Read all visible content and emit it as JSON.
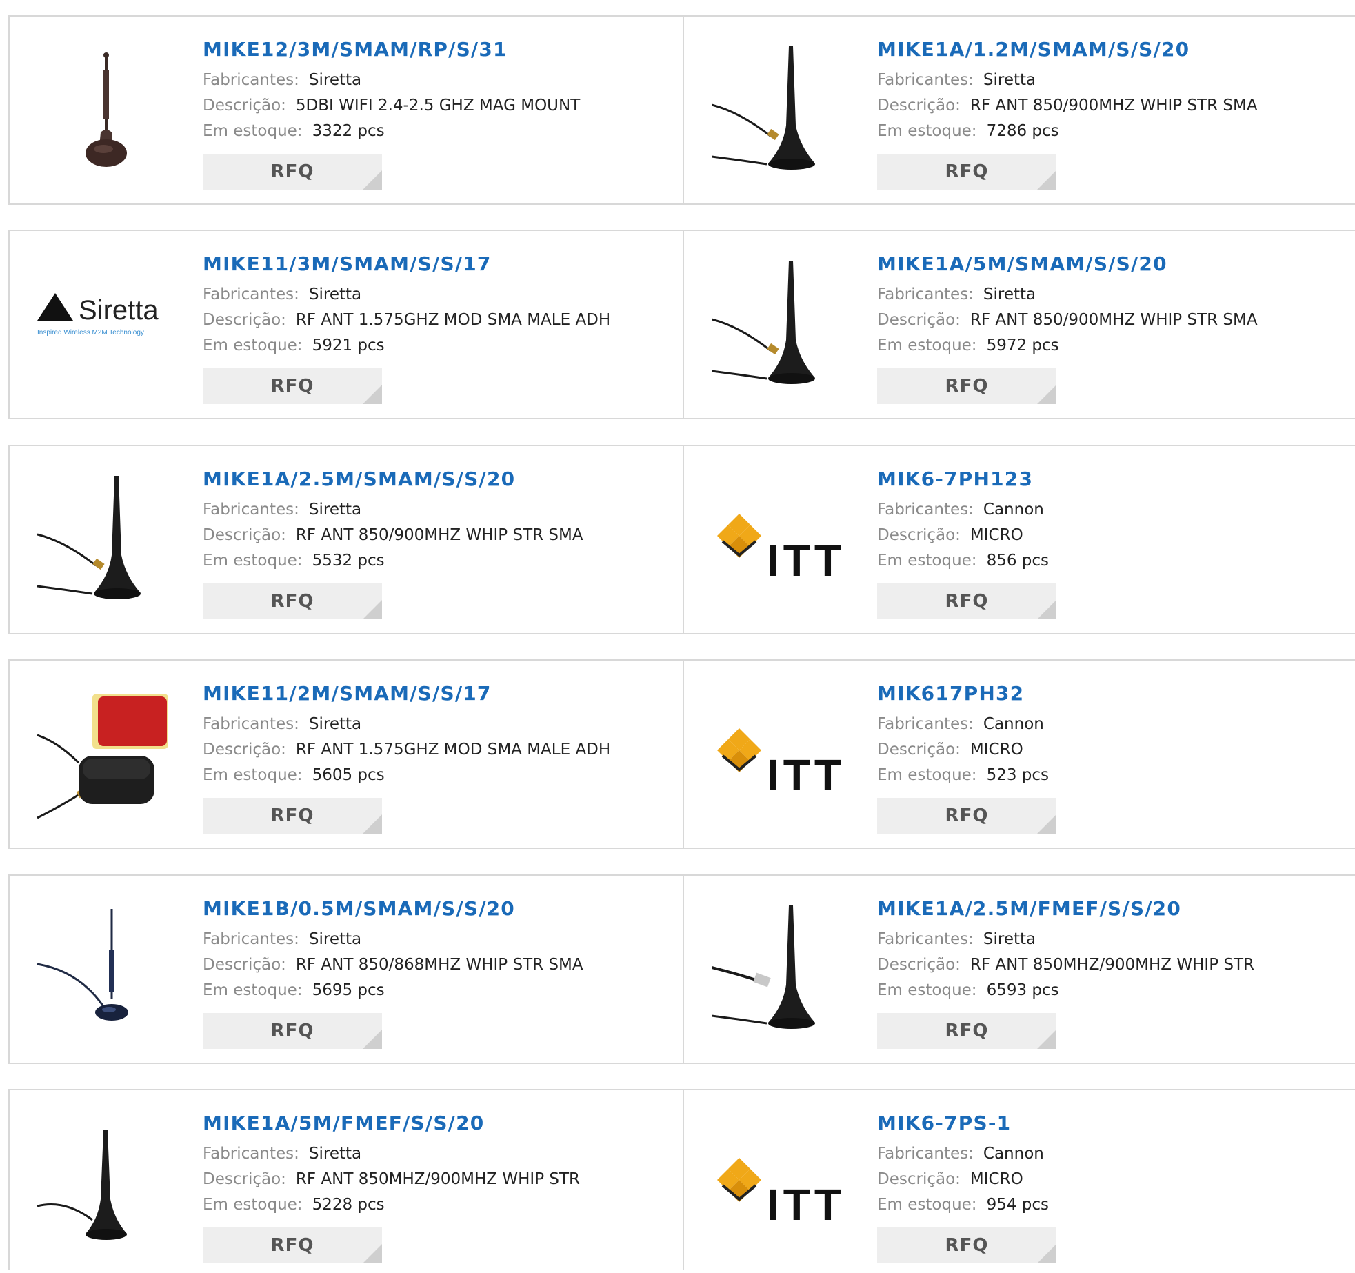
{
  "labels": {
    "manufacturer": "Fabricantes:",
    "description": "Descrição:",
    "stock": "Em estoque:",
    "rfq": "RFQ"
  },
  "products": [
    {
      "part": "MIKE12/3M/SMAM/RP/S/31",
      "manufacturer": "Siretta",
      "description": "5DBI WIFI 2.4-2.5 GHZ MAG MOUNT",
      "stock": "3322 pcs",
      "image": "whip-antenna-brown"
    },
    {
      "part": "MIKE1A/1.2M/SMAM/S/S/20",
      "manufacturer": "Siretta",
      "description": "RF ANT 850/900MHZ WHIP STR SMA",
      "stock": "7286 pcs",
      "image": "magnetic-antenna"
    },
    {
      "part": "MIKE11/3M/SMAM/S/S/17",
      "manufacturer": "Siretta",
      "description": "RF ANT 1.575GHZ MOD SMA MALE ADH",
      "stock": "5921 pcs",
      "image": "siretta-logo",
      "logo_name": "Siretta",
      "logo_tagline": "Inspired Wireless M2M Technology"
    },
    {
      "part": "MIKE1A/5M/SMAM/S/S/20",
      "manufacturer": "Siretta",
      "description": "RF ANT 850/900MHZ WHIP STR SMA",
      "stock": "5972 pcs",
      "image": "magnetic-antenna"
    },
    {
      "part": "MIKE1A/2.5M/SMAM/S/S/20",
      "manufacturer": "Siretta",
      "description": "RF ANT 850/900MHZ WHIP STR SMA",
      "stock": "5532 pcs",
      "image": "magnetic-antenna"
    },
    {
      "part": "MIK6-7PH123",
      "manufacturer": "Cannon",
      "description": "MICRO",
      "stock": "856 pcs",
      "image": "itt-logo",
      "logo_name": "ITT"
    },
    {
      "part": "MIKE11/2M/SMAM/S/S/17",
      "manufacturer": "Siretta",
      "description": "RF ANT 1.575GHZ MOD SMA MALE ADH",
      "stock": "5605 pcs",
      "image": "gps-puck-antenna"
    },
    {
      "part": "MIK617PH32",
      "manufacturer": "Cannon",
      "description": "MICRO",
      "stock": "523 pcs",
      "image": "itt-logo",
      "logo_name": "ITT"
    },
    {
      "part": "MIKE1B/0.5M/SMAM/S/S/20",
      "manufacturer": "Siretta",
      "description": "RF ANT 850/868MHZ WHIP STR SMA",
      "stock": "5695 pcs",
      "image": "whip-antenna-blue"
    },
    {
      "part": "MIKE1A/2.5M/FMEF/S/S/20",
      "manufacturer": "Siretta",
      "description": "RF ANT 850MHZ/900MHZ WHIP STR",
      "stock": "6593 pcs",
      "image": "magnetic-antenna-fme"
    },
    {
      "part": "MIKE1A/5M/FMEF/S/S/20",
      "manufacturer": "Siretta",
      "description": "RF ANT 850MHZ/900MHZ WHIP STR",
      "stock": "5228 pcs",
      "image": "magnetic-antenna-short"
    },
    {
      "part": "MIK6-7PS-1",
      "manufacturer": "Cannon",
      "description": "MICRO",
      "stock": "954 pcs",
      "image": "itt-logo",
      "logo_name": "ITT"
    }
  ]
}
